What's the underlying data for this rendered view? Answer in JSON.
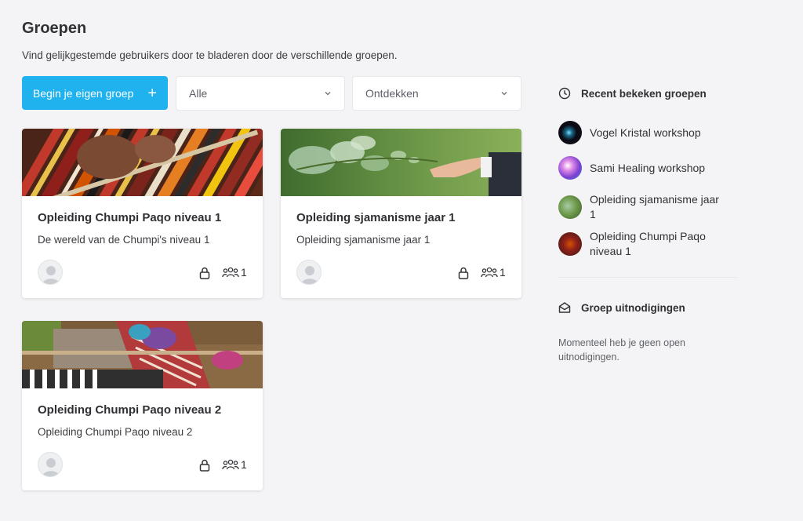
{
  "page": {
    "title": "Groepen",
    "subtitle": "Vind gelijkgestemde gebruikers door te bladeren door de verschillende groepen."
  },
  "toolbar": {
    "create_label": "Begin je eigen groep",
    "create_icon": "plus-icon",
    "filter_type_value": "Alle",
    "filter_order_value": "Ontdekken",
    "accent_color": "#1fb2ee"
  },
  "groups": [
    {
      "title": "Opleiding Chumpi Paqo niveau 1",
      "description": "De wereld van de Chumpi's niveau 1",
      "member_count": "1",
      "private": true,
      "cover": "weaving-hands-image"
    },
    {
      "title": "Opleiding sjamanisme jaar 1",
      "description": "Opleiding sjamanisme jaar 1",
      "member_count": "1",
      "private": true,
      "cover": "hand-and-plant-image"
    },
    {
      "title": "Opleiding Chumpi Paqo niveau 2",
      "description": "Opleiding Chumpi Paqo niveau 2",
      "member_count": "1",
      "private": true,
      "cover": "loom-weaving-image"
    }
  ],
  "sidebar": {
    "recent_title": "Recent bekeken groepen",
    "recent_icon": "clock-icon",
    "recent": [
      {
        "label": "Vogel Kristal workshop"
      },
      {
        "label": "Sami Healing workshop"
      },
      {
        "label": "Opleiding sjamanisme jaar 1"
      },
      {
        "label": "Opleiding Chumpi Paqo niveau 1"
      }
    ],
    "invites_title": "Groep uitnodigingen",
    "invites_icon": "envelope-open-icon",
    "invites_empty": "Momenteel heb je geen open uitnodigingen."
  }
}
